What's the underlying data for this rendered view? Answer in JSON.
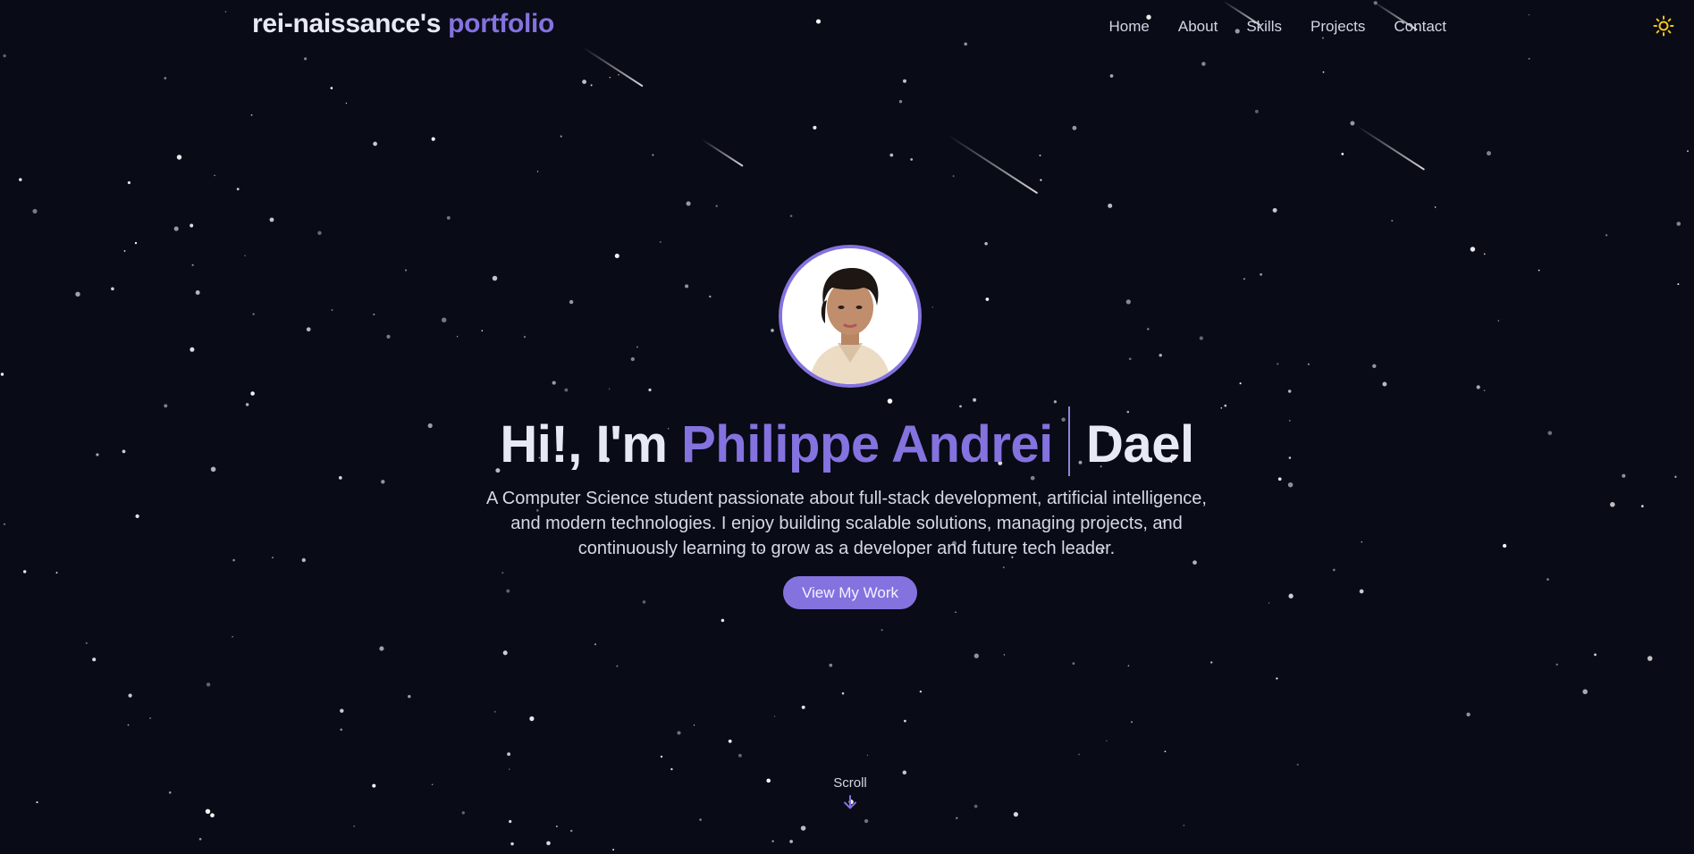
{
  "header": {
    "brand_main": "rei-naissance's",
    "brand_accent": "portfolio",
    "nav": [
      "Home",
      "About",
      "Skills",
      "Projects",
      "Contact"
    ],
    "theme_toggle_icon": "sun-icon"
  },
  "hero": {
    "greeting": "Hi!, I'm",
    "name_highlight": "Philippe Andrei",
    "name_rest": "Dael",
    "bio": "A Computer Science student passionate about full-stack development, artificial intelligence, and modern technologies. I enjoy building scalable solutions, managing projects, and continuously learning to grow as a developer and future tech leader.",
    "cta_label": "View My Work",
    "avatar_icon": "profile-photo"
  },
  "scroll": {
    "label": "Scroll",
    "icon": "arrow-down-icon"
  },
  "colors": {
    "background": "#090b16",
    "accent": "#8472df",
    "text": "#e7e9f5",
    "toggle": "#f5c518"
  }
}
